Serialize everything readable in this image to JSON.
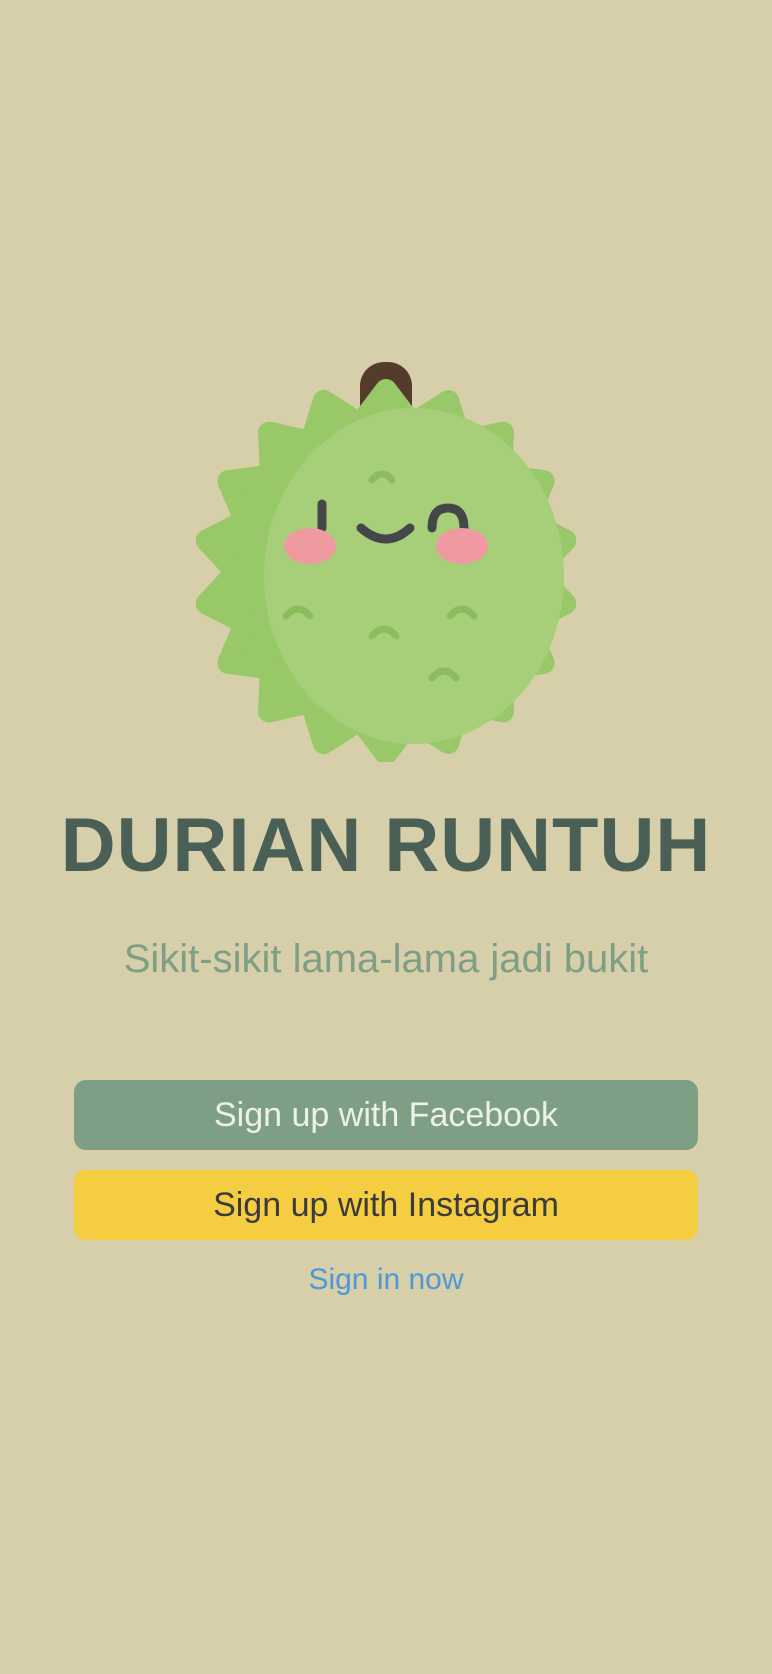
{
  "app": {
    "title": "DURIAN RUNTUH",
    "tagline": "Sikit-sikit lama-lama jadi bukit"
  },
  "mascot": {
    "icon": "durian-mascot-icon",
    "colors": {
      "body": "#a7cf79",
      "body_shade": "#98c868",
      "stem": "#553b2c",
      "cheek": "#ee9aa0",
      "face": "#45464a",
      "spike_mark": "#8dbc5e"
    }
  },
  "actions": {
    "facebook_label": "Sign up with Facebook",
    "instagram_label": "Sign up with Instagram",
    "signin_label": "Sign in now"
  },
  "colors": {
    "background": "#d7cfa9",
    "title": "#4a5f56",
    "tagline": "#7e9e86",
    "facebook_button": "#7e9e86",
    "instagram_button": "#f4cd40",
    "link": "#4f98d6"
  }
}
